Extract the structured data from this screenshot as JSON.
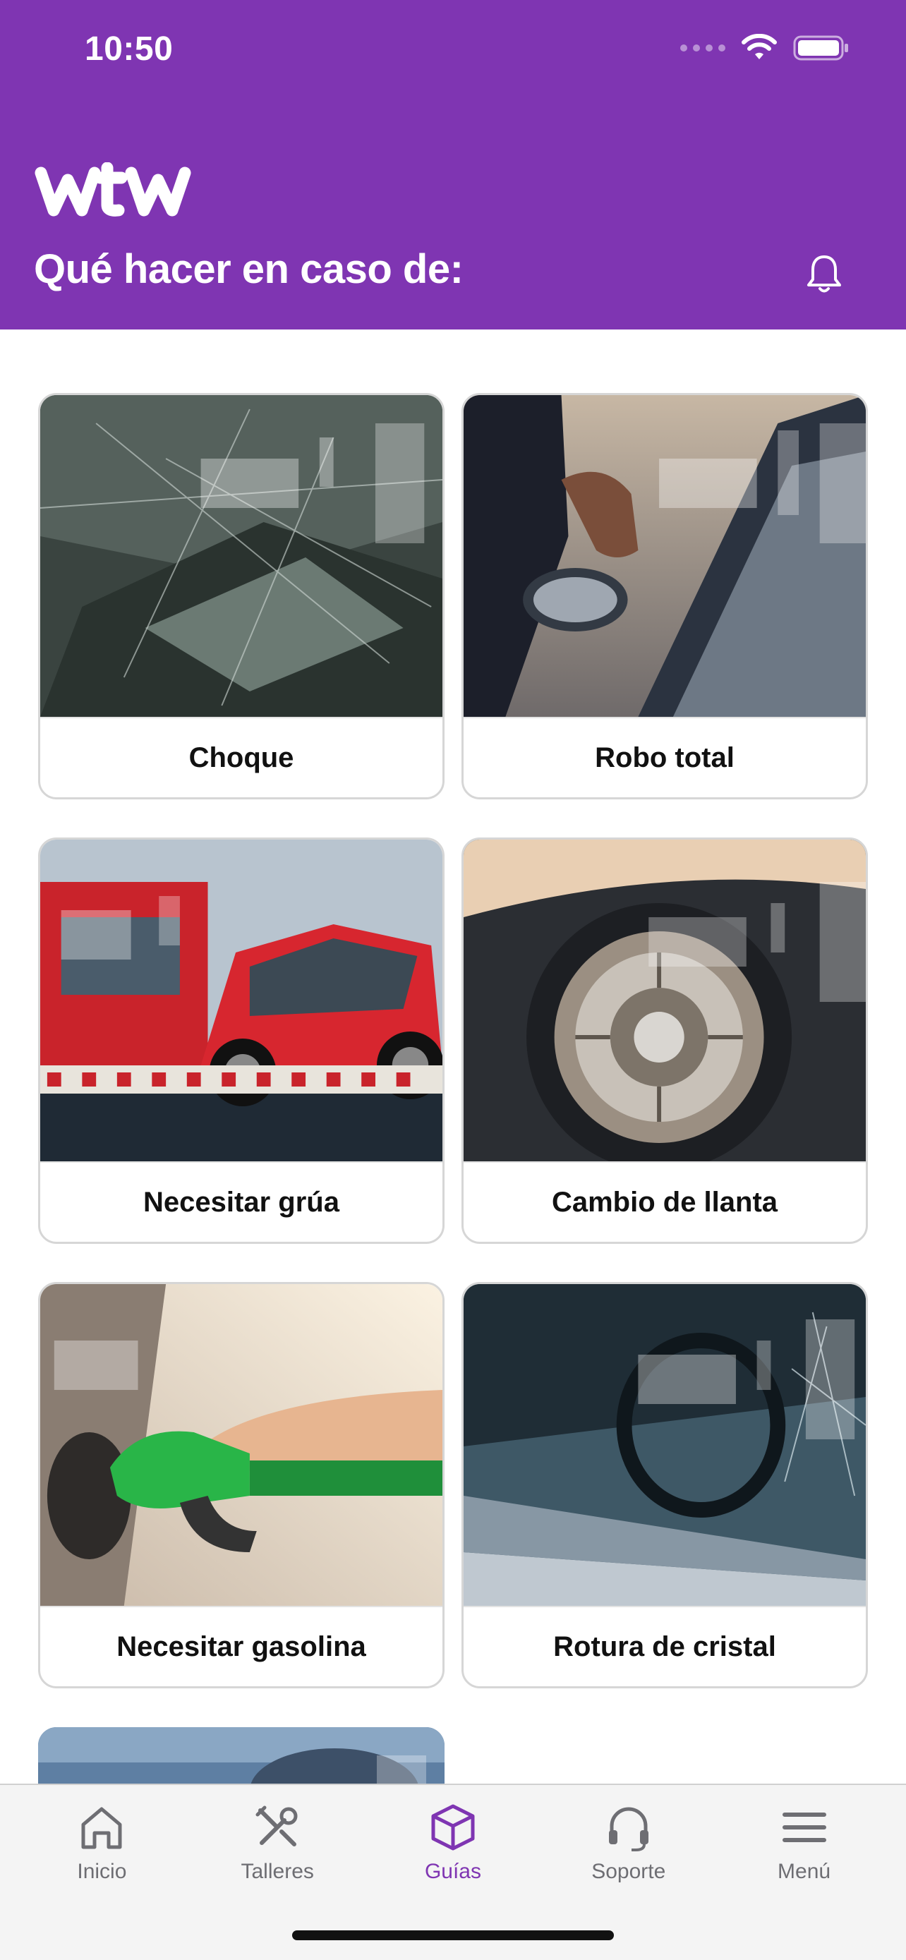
{
  "status_bar": {
    "time": "10:50"
  },
  "header": {
    "logo_text": "wtw",
    "title": "Qué hacer en caso de:",
    "bell_icon": "bell-icon"
  },
  "guides": [
    {
      "label": "Choque",
      "image": "broken-windshield-crash"
    },
    {
      "label": "Robo total",
      "image": "car-theft"
    },
    {
      "label": "Necesitar grúa",
      "image": "tow-truck"
    },
    {
      "label": "Cambio de llanta",
      "image": "flat-tire"
    },
    {
      "label": "Necesitar gasolina",
      "image": "fuel-pump"
    },
    {
      "label": "Rotura de cristal",
      "image": "broken-window"
    }
  ],
  "tabbar": {
    "items": [
      {
        "label": "Inicio",
        "icon": "home-icon",
        "active": false
      },
      {
        "label": "Talleres",
        "icon": "tools-icon",
        "active": false
      },
      {
        "label": "Guías",
        "icon": "box-icon",
        "active": true
      },
      {
        "label": "Soporte",
        "icon": "headset-icon",
        "active": false
      },
      {
        "label": "Menú",
        "icon": "menu-icon",
        "active": false
      }
    ]
  },
  "colors": {
    "brand": "#7f35b2",
    "tab_inactive": "#6e6e73"
  }
}
